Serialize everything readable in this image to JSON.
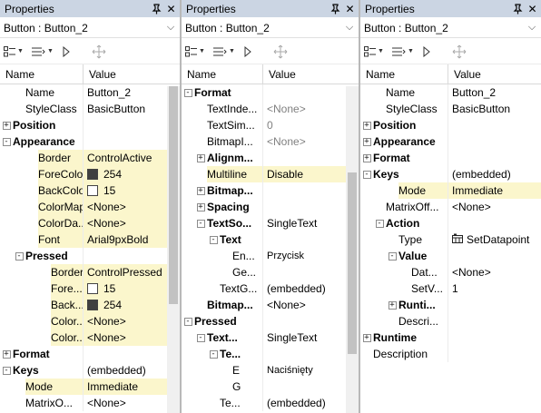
{
  "panels": [
    {
      "title": "Properties",
      "object": "Button : Button_2",
      "header": {
        "name": "Name",
        "value": "Value"
      },
      "rows": [
        {
          "level": 1,
          "name": "Name",
          "value": "Button_2"
        },
        {
          "level": 1,
          "name": "StyleClass",
          "value": "BasicButton"
        },
        {
          "level": 0,
          "exp": "+",
          "name": "Position",
          "value": "",
          "bold": true
        },
        {
          "level": 0,
          "exp": "-",
          "name": "Appearance",
          "value": "",
          "bold": true
        },
        {
          "level": 2,
          "name": "Border",
          "value": "ControlActive",
          "hl": true
        },
        {
          "level": 2,
          "name": "ForeColor",
          "value": "254",
          "swatch": "#404040",
          "hl": true
        },
        {
          "level": 2,
          "name": "BackColor",
          "value": "15",
          "swatch": "#ffffff",
          "hl": true
        },
        {
          "level": 2,
          "name": "ColorMap",
          "value": "<None>",
          "hl": true
        },
        {
          "level": 2,
          "name": "ColorDa...",
          "value": "<None>",
          "hl": true
        },
        {
          "level": 2,
          "name": "Font",
          "value": "Arial9pxBold",
          "hl": true
        },
        {
          "level": 1,
          "exp": "-",
          "name": "Pressed",
          "value": "",
          "bold": true
        },
        {
          "level": 3,
          "name": "Border",
          "value": "ControlPressed",
          "hl": true
        },
        {
          "level": 3,
          "name": "Fore...",
          "value": "15",
          "swatch": "#ffffff",
          "hl": true
        },
        {
          "level": 3,
          "name": "Back...",
          "value": "254",
          "swatch": "#404040",
          "hl": true
        },
        {
          "level": 3,
          "name": "Color...",
          "value": "<None>",
          "hl": true
        },
        {
          "level": 3,
          "name": "Color...",
          "value": "<None>",
          "hl": true
        },
        {
          "level": 0,
          "exp": "+",
          "name": "Format",
          "value": "",
          "bold": true
        },
        {
          "level": 0,
          "exp": "-",
          "name": "Keys",
          "value": "(embedded)",
          "bold": true
        },
        {
          "level": 1,
          "name": "Mode",
          "value": "Immediate",
          "hl": true
        },
        {
          "level": 1,
          "name": "MatrixO...",
          "value": "<None>"
        }
      ]
    },
    {
      "title": "Properties",
      "object": "Button : Button_2",
      "header": {
        "name": "Name",
        "value": "Value"
      },
      "rows": [
        {
          "level": 0,
          "exp": "-",
          "name": "Format",
          "value": "",
          "bold": true
        },
        {
          "level": 1,
          "name": "TextInde...",
          "value": "<None>",
          "gray": true
        },
        {
          "level": 1,
          "name": "TextSim...",
          "value": "0",
          "gray": true
        },
        {
          "level": 1,
          "name": "BitmapI...",
          "value": "<None>",
          "gray": true
        },
        {
          "level": 1,
          "exp": "+",
          "name": "Alignm...",
          "value": "",
          "bold": true
        },
        {
          "level": 1,
          "name": "Multiline",
          "value": "Disable",
          "hl": true
        },
        {
          "level": 1,
          "exp": "+",
          "name": "Bitmap...",
          "value": "",
          "bold": true
        },
        {
          "level": 1,
          "exp": "+",
          "name": "Spacing",
          "value": "",
          "bold": true
        },
        {
          "level": 1,
          "exp": "-",
          "name": "TextSo...",
          "value": "SingleText",
          "bold": true
        },
        {
          "level": 2,
          "exp": "-",
          "name": "Text",
          "value": "",
          "bold": true
        },
        {
          "level": 3,
          "name": "En...",
          "value": "Przycisk",
          "small": true
        },
        {
          "level": 3,
          "name": "Ge...",
          "value": ""
        },
        {
          "level": 2,
          "name": "TextG...",
          "value": "(embedded)"
        },
        {
          "level": 1,
          "name": "Bitmap...",
          "value": "<None>",
          "bold": true
        },
        {
          "level": 0,
          "exp": "-",
          "name": "Pressed",
          "value": "",
          "bold": true
        },
        {
          "level": 1,
          "exp": "-",
          "name": "Text...",
          "value": "SingleText",
          "bold": true
        },
        {
          "level": 2,
          "exp": "-",
          "name": "Te...",
          "value": "",
          "bold": true
        },
        {
          "level": 3,
          "name": "E",
          "value": "Naciśnięty",
          "small": true
        },
        {
          "level": 3,
          "name": "G",
          "value": ""
        },
        {
          "level": 2,
          "name": "Te...",
          "value": "(embedded)"
        }
      ]
    },
    {
      "title": "Properties",
      "object": "Button : Button_2",
      "header": {
        "name": "Name",
        "value": "Value"
      },
      "rows": [
        {
          "level": 1,
          "name": "Name",
          "value": "Button_2"
        },
        {
          "level": 1,
          "name": "StyleClass",
          "value": "BasicButton"
        },
        {
          "level": 0,
          "exp": "+",
          "name": "Position",
          "value": "",
          "bold": true
        },
        {
          "level": 0,
          "exp": "+",
          "name": "Appearance",
          "value": "",
          "bold": true
        },
        {
          "level": 0,
          "exp": "+",
          "name": "Format",
          "value": "",
          "bold": true
        },
        {
          "level": 0,
          "exp": "-",
          "name": "Keys",
          "value": "(embedded)",
          "bold": true
        },
        {
          "level": 2,
          "name": "Mode",
          "value": "Immediate",
          "hl": true
        },
        {
          "level": 1,
          "name": "MatrixOff...",
          "value": "<None>"
        },
        {
          "level": 1,
          "exp": "-",
          "name": "Action",
          "value": "",
          "bold": true
        },
        {
          "level": 2,
          "name": "Type",
          "value": "SetDatapoint",
          "icon": true
        },
        {
          "level": 2,
          "exp": "-",
          "name": "Value",
          "value": "",
          "bold": true
        },
        {
          "level": 3,
          "name": "Dat...",
          "value": "<None>"
        },
        {
          "level": 3,
          "name": "SetV...",
          "value": "1"
        },
        {
          "level": 2,
          "exp": "+",
          "name": "Runti...",
          "value": "",
          "bold": true
        },
        {
          "level": 2,
          "name": "Descri...",
          "value": ""
        },
        {
          "level": 0,
          "exp": "+",
          "name": "Runtime",
          "value": "",
          "bold": true
        },
        {
          "level": 0,
          "name": "Description",
          "value": ""
        }
      ]
    }
  ]
}
